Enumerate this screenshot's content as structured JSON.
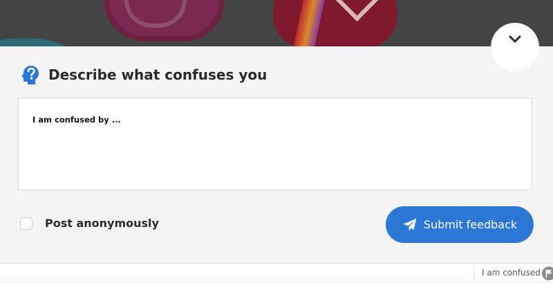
{
  "panel": {
    "title": "Describe what confuses you",
    "textarea_placeholder": "I am confused by ...",
    "anonymous_label": "Post anonymously",
    "anonymous_checked": false,
    "submit_label": "Submit feedback"
  },
  "footer": {
    "confused_label": "I am confused"
  },
  "colors": {
    "accent": "#2b78d6",
    "panel_bg": "#f4f4f4",
    "overlay": "#444444"
  },
  "icons": {
    "collapse": "chevron-down-icon",
    "heading": "question-head-icon",
    "submit": "paper-plane-icon",
    "footer": "flag-icon"
  }
}
